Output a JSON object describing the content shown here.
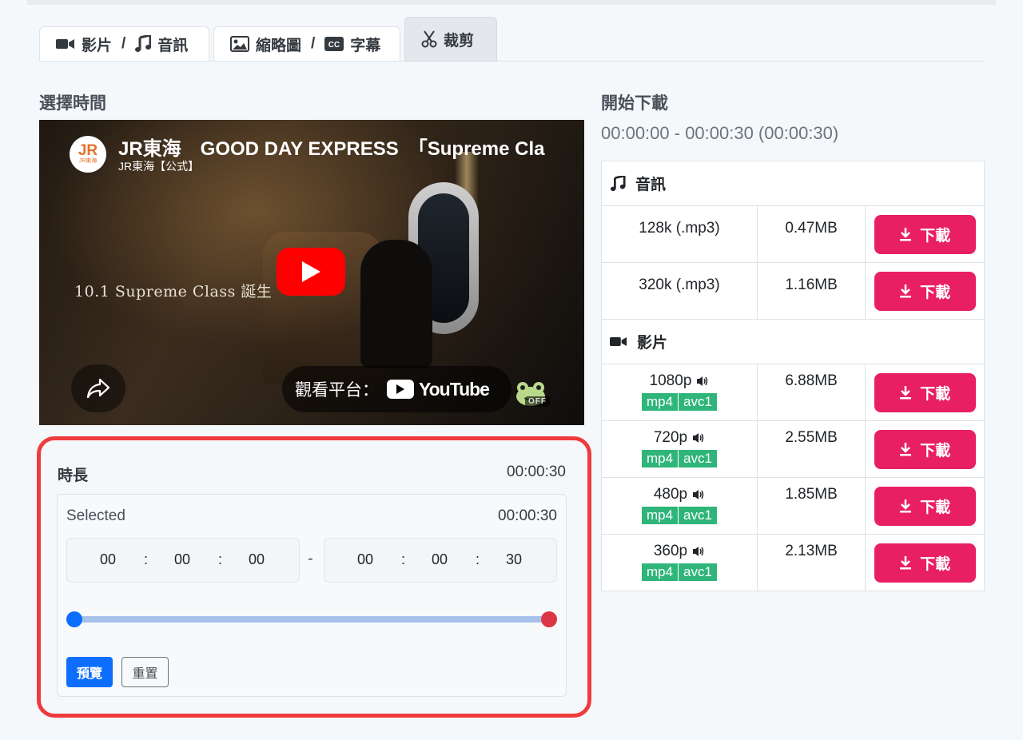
{
  "tabs": [
    {
      "label_a": "影片",
      "label_b": "音訊",
      "icon_a": "video-camera-icon",
      "icon_b": "music-note-icon"
    },
    {
      "label_a": "縮略圖",
      "label_b": "字幕",
      "icon_a": "image-icon",
      "icon_b": "cc-icon"
    },
    {
      "label": "裁剪",
      "icon": "scissors-icon",
      "active": true
    }
  ],
  "tab_separator": "/",
  "left": {
    "section_title": "選擇時間",
    "video": {
      "title": "JR東海　GOOD DAY EXPRESS　「Supreme Cla",
      "channel": "JR東海【公式】",
      "channel_logo_text": "JR",
      "channel_logo_sub": "JR東海",
      "overlay_text": "10.1 Supreme Class 誕生",
      "watch_on": "觀看平台：",
      "youtube": "YouTube",
      "cc_state": "OFF"
    },
    "duration": {
      "label": "時長",
      "value": "00:00:30"
    },
    "selected": {
      "label": "Selected",
      "value": "00:00:30",
      "start": {
        "h": "00",
        "m": "00",
        "s": "00"
      },
      "end": {
        "h": "00",
        "m": "00",
        "s": "30"
      },
      "colon": ":",
      "dash": "-",
      "slider_start_fraction": 0,
      "slider_end_fraction": 1
    },
    "preview_label": "預覽",
    "reset_label": "重置"
  },
  "right": {
    "section_title": "開始下載",
    "range_text": "00:00:00 - 00:00:30 (00:00:30)",
    "audio_heading": "音訊",
    "video_heading": "影片",
    "download_label": "下載",
    "audio": [
      {
        "quality": "128k (.mp3)",
        "size": "0.47MB"
      },
      {
        "quality": "320k (.mp3)",
        "size": "1.16MB"
      }
    ],
    "video": [
      {
        "quality": "1080p",
        "size": "6.88MB",
        "container": "mp4",
        "codec": "avc1"
      },
      {
        "quality": "720p",
        "size": "2.55MB",
        "container": "mp4",
        "codec": "avc1"
      },
      {
        "quality": "480p",
        "size": "1.85MB",
        "container": "mp4",
        "codec": "avc1"
      },
      {
        "quality": "360p",
        "size": "2.13MB",
        "container": "mp4",
        "codec": "avc1"
      }
    ]
  },
  "colors": {
    "download_button": "#e81f63",
    "badge": "#2fb57a",
    "highlight_border": "#ef3b3d",
    "preview_button": "#0d6efd",
    "slider_start_knob": "#0d6efd",
    "slider_end_knob": "#dc3545"
  }
}
